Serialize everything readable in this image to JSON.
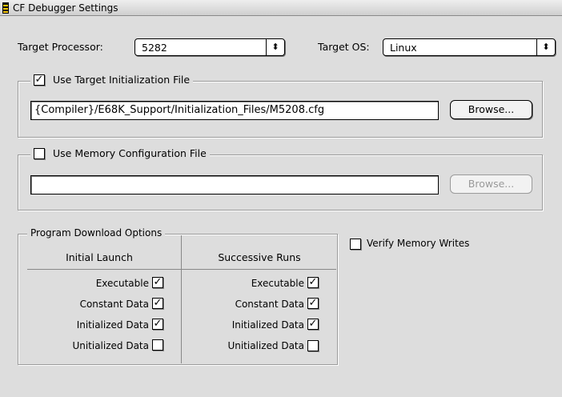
{
  "window": {
    "title": "CF Debugger Settings"
  },
  "target": {
    "processor_label": "Target Processor:",
    "processor_value": "5282",
    "os_label": "Target OS:",
    "os_value": "Linux"
  },
  "init_file": {
    "label": "Use Target Initialization File",
    "checked": true,
    "path": "{Compiler}/E68K_Support/Initialization_Files/M5208.cfg",
    "browse_label": "Browse..."
  },
  "mem_config": {
    "label": "Use Memory Configuration File",
    "checked": false,
    "path": "",
    "browse_label": "Browse..."
  },
  "download": {
    "label": "Program Download Options",
    "col1_header": "Initial Launch",
    "col2_header": "Successive Runs",
    "rows": [
      {
        "label": "Executable",
        "initial": true,
        "successive": true
      },
      {
        "label": "Constant Data",
        "initial": true,
        "successive": true
      },
      {
        "label": "Initialized Data",
        "initial": true,
        "successive": true
      },
      {
        "label": "Unitialized Data",
        "initial": false,
        "successive": false
      }
    ]
  },
  "verify": {
    "label": "Verify Memory Writes",
    "checked": false
  },
  "glyphs": {
    "check": "✓",
    "popup_arrow": "⬍"
  }
}
